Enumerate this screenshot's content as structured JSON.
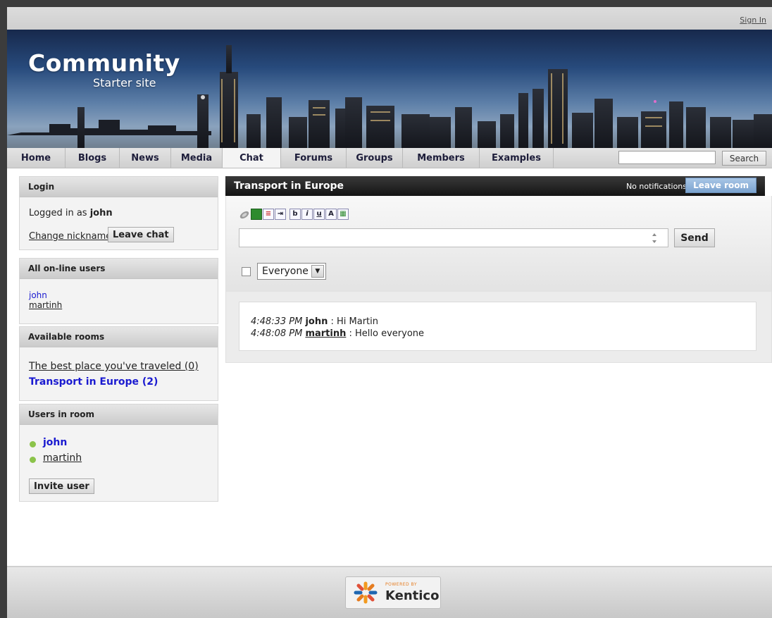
{
  "topbar": {
    "sign_in": "Sign In"
  },
  "header": {
    "logo_title": "Community",
    "logo_subtitle": "Starter site"
  },
  "nav": {
    "items": [
      "Home",
      "Blogs",
      "News",
      "Media",
      "Chat",
      "Forums",
      "Groups",
      "Members",
      "Examples"
    ],
    "active": "Chat",
    "search_button": "Search",
    "search_value": ""
  },
  "login": {
    "title": "Login",
    "logged_in_prefix": "Logged in as",
    "username": "john",
    "change_nickname": "Change nickname",
    "leave_chat": "Leave chat"
  },
  "online_users": {
    "title": "All on-line users",
    "users": [
      "john",
      "martinh"
    ]
  },
  "rooms": {
    "title": "Available rooms",
    "items": [
      {
        "label": "The best place you've traveled (0)",
        "current": false
      },
      {
        "label": "Transport in Europe (2)",
        "current": true
      }
    ]
  },
  "room_users": {
    "title": "Users in room",
    "users": [
      "john",
      "martinh"
    ],
    "status_color": "#8bc34a",
    "invite_button": "Invite user"
  },
  "chat": {
    "room_title": "Transport in Europe",
    "notifications": "No notifications",
    "leave_room": "Leave room",
    "toolbar_icons": [
      "smiley-icon",
      "color-icon",
      "list-icon",
      "indent-icon",
      "bold-icon",
      "italic-icon",
      "underline-icon",
      "strike-icon",
      "table-icon"
    ],
    "toolbar_labels": {
      "bold": "b",
      "italic": "i",
      "underline": "u"
    },
    "message_value": "",
    "send_button": "Send",
    "private_checked": false,
    "recipient": "Everyone",
    "messages": [
      {
        "time": "4:48:33 PM",
        "user": "john",
        "text": ": Hi Martin"
      },
      {
        "time": "4:48:08 PM",
        "user": "martinh",
        "text": ": Hello everyone"
      }
    ]
  },
  "footer": {
    "powered_by": "POWERED BY",
    "brand": "Kentico"
  },
  "colors": {
    "active_room": "#1a1ad0",
    "leave_room": "#8bb0d9",
    "chat_header": "#1f1f1f"
  }
}
